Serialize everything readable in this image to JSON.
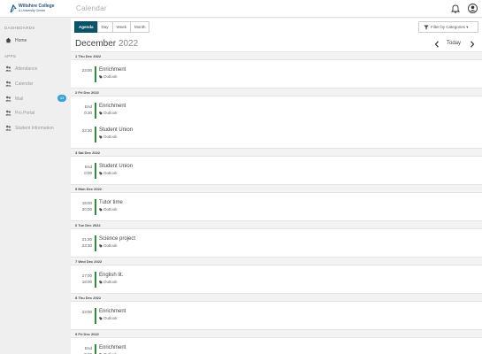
{
  "topbar": {
    "logo_line1": "Wiltshire College",
    "logo_line2": "& University Centre",
    "page_title": "Calendar"
  },
  "sidebar": {
    "dashboards_label": "DASHBOARDS",
    "apps_label": "APPS",
    "home": "Home",
    "apps": [
      {
        "label": "Attendance",
        "icon": "people-icon"
      },
      {
        "label": "Calendar",
        "icon": "people-icon"
      },
      {
        "label": "Mail",
        "icon": "people-icon",
        "badge": "43"
      },
      {
        "label": "Pro Portal",
        "icon": "people-icon"
      },
      {
        "label": "Student Information",
        "icon": "people-icon"
      }
    ]
  },
  "toolbar": {
    "views": [
      "Agenda",
      "Day",
      "Week",
      "Month"
    ],
    "active_view": "Agenda",
    "filter_label": "Filter by Categories ▾"
  },
  "calendar": {
    "month": "December",
    "year": "2022",
    "today_label": "Today"
  },
  "agenda": [
    {
      "date": "1 Thu Dec 2022",
      "events": [
        {
          "start": "23:00",
          "end": "",
          "title": "Enrichment",
          "source": "Outlook"
        }
      ]
    },
    {
      "date": "2 Fri Dec 2022",
      "events": [
        {
          "start": "End",
          "end": "0:30",
          "title": "Enrichment",
          "source": "Outlook"
        },
        {
          "start": "23:30",
          "end": "",
          "title": "Student Union",
          "source": "Outlook"
        }
      ]
    },
    {
      "date": "3 Sat Dec 2022",
      "events": [
        {
          "start": "End",
          "end": "0:00",
          "title": "Student Union",
          "source": "Outlook"
        }
      ]
    },
    {
      "date": "5 Mon Dec 2022",
      "events": [
        {
          "start": "19:00",
          "end": "20:00",
          "title": "Tutor time",
          "source": "Outlook"
        }
      ]
    },
    {
      "date": "6 Tue Dec 2022",
      "events": [
        {
          "start": "21:30",
          "end": "23:30",
          "title": "Science project",
          "source": "Outlook"
        }
      ]
    },
    {
      "date": "7 Wed Dec 2022",
      "events": [
        {
          "start": "17:00",
          "end": "18:00",
          "title": "English lit.",
          "source": "Outlook"
        }
      ]
    },
    {
      "date": "8 Thu Dec 2022",
      "events": [
        {
          "start": "23:00",
          "end": "",
          "title": "Enrichment",
          "source": "Outlook"
        }
      ]
    },
    {
      "date": "9 Fri Dec 2022",
      "events": [
        {
          "start": "End",
          "end": "0:30",
          "title": "Enrichment",
          "source": "Outlook"
        }
      ]
    }
  ],
  "colors": {
    "accent": "#0b5366",
    "event_bar": "#2e8b3e",
    "badge": "#3aa0d8"
  }
}
